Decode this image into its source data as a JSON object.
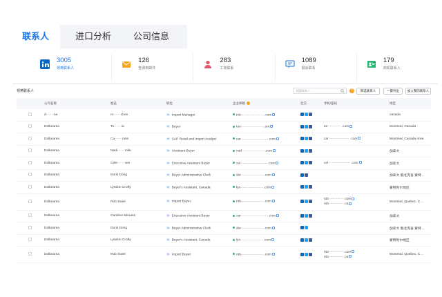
{
  "tabs": [
    {
      "label": "联系人",
      "active": true
    },
    {
      "label": "进口分析",
      "active": false
    },
    {
      "label": "公司信息",
      "active": false
    }
  ],
  "stats": [
    {
      "icon": "linkedin-icon",
      "color": "#0a66c2",
      "value": "3005",
      "label": "领英联系人"
    },
    {
      "icon": "mail-icon",
      "color": "#f5a623",
      "value": "126",
      "label": "查询到邮件"
    },
    {
      "icon": "person-icon",
      "color": "#e0566b",
      "value": "283",
      "label": "工商联系"
    },
    {
      "icon": "chat-icon",
      "color": "#3d8be0",
      "value": "1089",
      "label": "展会联系"
    },
    {
      "icon": "contact-card-icon",
      "color": "#2bb673",
      "value": "179",
      "label": "商机联系人"
    }
  ],
  "toolbar": {
    "title": "领英联系人",
    "search_placeholder": "搜索联系人",
    "buttons": [
      "筛选联系人",
      "一键导出",
      "加入我的联系人"
    ]
  },
  "table": {
    "headers": [
      "公司名称",
      "姓名",
      "职位",
      "企业邮箱",
      "社交",
      "手机/座机",
      "地区"
    ],
    "rows": [
      {
        "company": "d·······na",
        "name": "m······ chen",
        "title": "Import Manager",
        "email": "mic·····················.com",
        "social": [
          "li",
          "tw",
          "fb"
        ],
        "phones": [],
        "region": "canada",
        "tall": false
      },
      {
        "company": "Dollarama",
        "name": "To······ ia",
        "title": "Buyer",
        "email": "ton·····················.om",
        "social": [
          "li",
          "tw",
          "fb"
        ],
        "phones": [
          "tor ··········· .com"
        ],
        "region": "Montreal, Canada",
        "tall": false
      },
      {
        "company": "Dollarama",
        "name": "Ca······ nion",
        "title": "SAP Retail and Import Analyst",
        "email": "car·························.com",
        "social": [
          "li",
          "tw",
          "fb"
        ],
        "phones": [
          "car ·················· .com"
        ],
        "region": "Montreal, Canada Area",
        "tall": false
      },
      {
        "company": "Dollarama",
        "name": "Nadi······ mila",
        "title": "Assistant Buyer",
        "email": "nad·····················.com",
        "social": [
          "li",
          "tw",
          "fb"
        ],
        "phones": [],
        "region": "加拿大",
        "tall": false
      },
      {
        "company": "Dollarama",
        "name": "Cele······ ves",
        "title": "Executive Assistant Buyer",
        "email": "cel·························.com",
        "social": [
          "li",
          "tw",
          "fb"
        ],
        "phones": [
          "cel ··················· .com"
        ],
        "region": "加拿大",
        "tall": false
      },
      {
        "company": "Dollarama",
        "name": "Doris Dong",
        "title": "Buyer Administrative Clerk",
        "email": "dor·····················.com",
        "social": [
          "li",
          "fb"
        ],
        "phones": [],
        "region": "加拿大 魁北克省 蒙特…",
        "tall": false
      },
      {
        "company": "Dollarama",
        "name": "Lyndon Crofty",
        "title": "Buyer's Assistant, Canada",
        "email": "lyn·····················.com",
        "social": [
          "li",
          "tw",
          "fb"
        ],
        "phones": [],
        "region": "蒙特利尔地区",
        "tall": false
      },
      {
        "company": "Dollarama",
        "name": "Rob Swiel",
        "title": "Import Buyer",
        "email": "rob·····················.com",
        "social": [
          "li",
          "tw",
          "fb"
        ],
        "phones": [
          "rob ·············.com",
          "rob ·············.ca"
        ],
        "region": "Montreal, Quebec, C…",
        "tall": true
      },
      {
        "company": "Dollarama",
        "name": "Caroline Minuets",
        "title": "Executive Assistant Buyer",
        "email": "car·························.com",
        "social": [
          "li",
          "tw",
          "fb"
        ],
        "phones": [],
        "region": "加拿大",
        "tall": false
      },
      {
        "company": "Dollarama",
        "name": "Doris Dong",
        "title": "Buyer Administrative Clerk",
        "email": "dor·····················.com",
        "social": [
          "li",
          "tw"
        ],
        "phones": [],
        "region": "加拿大 魁北克省 蒙特…",
        "tall": false
      },
      {
        "company": "Dollarama",
        "name": "Lyndon Crofty",
        "title": "Buyer's Assistant, Canada",
        "email": "lyn·····················.com",
        "social": [
          "li",
          "tw",
          "fb"
        ],
        "phones": [],
        "region": "蒙特利尔地区",
        "tall": false
      },
      {
        "company": "Dollarama",
        "name": "Rob Swiel",
        "title": "Import Buyer",
        "email": "rob·····················.com",
        "social": [
          "li",
          "tw",
          "fb"
        ],
        "phones": [
          "rob ·············.com",
          "rob ·············.ca"
        ],
        "region": "Montreal, Quebec, C…",
        "tall": true
      }
    ]
  }
}
